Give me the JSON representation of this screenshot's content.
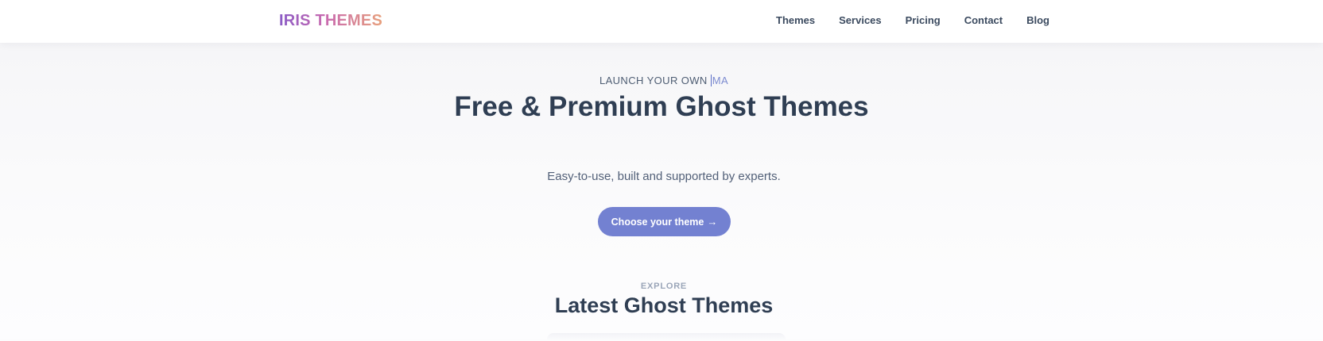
{
  "header": {
    "logo_text": "IRIS THEMES",
    "nav": [
      {
        "label": "Themes"
      },
      {
        "label": "Services"
      },
      {
        "label": "Pricing"
      },
      {
        "label": "Contact"
      },
      {
        "label": "Blog"
      }
    ]
  },
  "hero": {
    "eyebrow_static": "LAUNCH YOUR OWN ",
    "eyebrow_typed": "MA",
    "title": "Free & Premium Ghost Themes",
    "subtitle": "Easy-to-use, built and supported by experts.",
    "cta_label": "Choose your theme",
    "cta_arrow": "→"
  },
  "explore": {
    "label": "EXPLORE",
    "title": "Latest Ghost Themes"
  },
  "colors": {
    "brand_gradient": [
      "#8a5bc6",
      "#c96bb0",
      "#e7a07c"
    ],
    "accent": "#7381d1",
    "heading": "#2f3e53"
  }
}
